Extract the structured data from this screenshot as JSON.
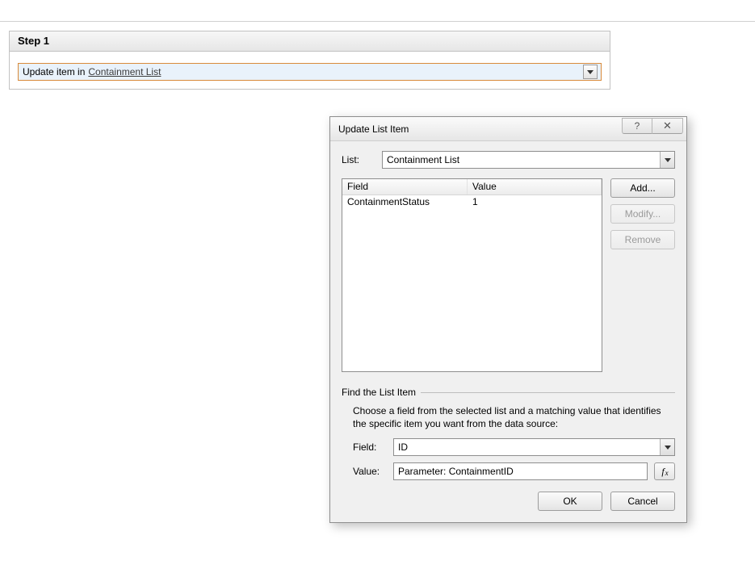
{
  "step": {
    "header": "Step 1",
    "action_prefix": "Update item in",
    "action_link": "Containment List"
  },
  "dialog": {
    "title": "Update List Item",
    "list_label": "List:",
    "list_value": "Containment List",
    "grid": {
      "col_field": "Field",
      "col_value": "Value",
      "rows": [
        {
          "field": "ContainmentStatus",
          "value": "1"
        }
      ]
    },
    "buttons": {
      "add": "Add...",
      "modify": "Modify...",
      "remove": "Remove"
    },
    "find": {
      "legend": "Find the List Item",
      "desc": "Choose a field from the selected list and a matching value that identifies the specific item you want from the data source:",
      "field_label": "Field:",
      "field_value": "ID",
      "value_label": "Value:",
      "value_value": "Parameter: ContainmentID"
    },
    "footer": {
      "ok": "OK",
      "cancel": "Cancel"
    }
  }
}
